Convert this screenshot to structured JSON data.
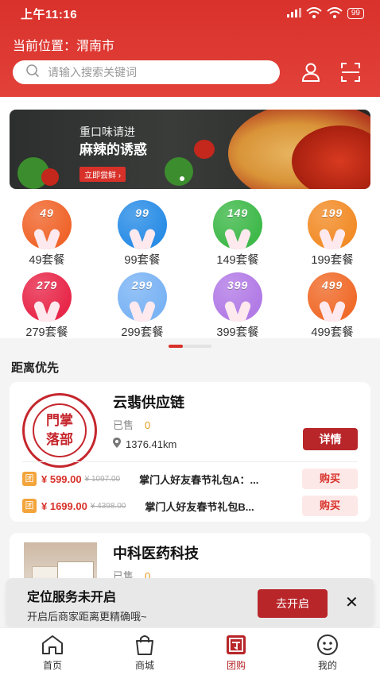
{
  "status_bar": {
    "time": "上午11:16",
    "battery": "99"
  },
  "header": {
    "location": "当前位置：渭南市",
    "search_placeholder": "请输入搜索关键词"
  },
  "banner": {
    "line1": "重口味请进",
    "line2": "麻辣的诱惑",
    "cta": "立即尝鲜 ›"
  },
  "packages": [
    {
      "num": "49",
      "label": "49套餐",
      "color": "#f0652b"
    },
    {
      "num": "99",
      "label": "99套餐",
      "color": "#2a8de6"
    },
    {
      "num": "149",
      "label": "149套餐",
      "color": "#3fb94a"
    },
    {
      "num": "199",
      "label": "199套餐",
      "color": "#f28c28"
    },
    {
      "num": "279",
      "label": "279套餐",
      "color": "#e8284a"
    },
    {
      "num": "299",
      "label": "299套餐",
      "color": "#7ab3f4"
    },
    {
      "num": "399",
      "label": "399套餐",
      "color": "#b27be6"
    },
    {
      "num": "499",
      "label": "499套餐",
      "color": "#f06b2a"
    }
  ],
  "section_title": "距离优先",
  "shops": [
    {
      "name": "云翡供应链",
      "logo_text": "門掌\n落部",
      "sold_label": "已售",
      "sold_count": "0",
      "distance": "1376.41km",
      "detail_label": "详情",
      "deals": [
        {
          "tag": "团",
          "price": "¥ 599.00",
          "orig": "¥ 1097.00",
          "name": "掌门人好友春节礼包A：...",
          "buy": "购买"
        },
        {
          "tag": "团",
          "price": "¥ 1699.00",
          "orig": "¥ 4398.00",
          "name": "掌门人好友春节礼包B...",
          "buy": "购买"
        }
      ]
    },
    {
      "name": "中科医药科技",
      "sold_label": "已售",
      "sold_count": "0"
    }
  ],
  "toast": {
    "title": "定位服务未开启",
    "subtitle": "开启后商家距离更精确哦~",
    "button": "去开启",
    "close": "✕"
  },
  "bottom_nav": [
    {
      "label": "首页",
      "icon": "home-icon"
    },
    {
      "label": "商城",
      "icon": "shopping-bag-icon"
    },
    {
      "label": "团购",
      "icon": "group-buy-icon"
    },
    {
      "label": "我的",
      "icon": "profile-icon"
    }
  ]
}
